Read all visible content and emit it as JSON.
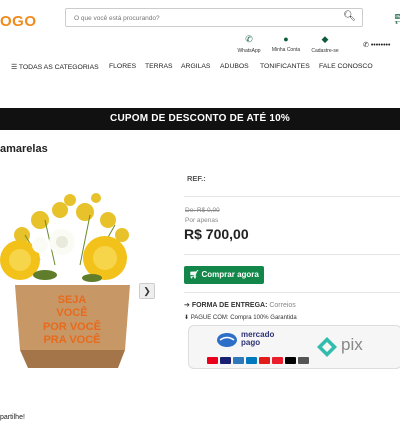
{
  "header": {
    "logo_text": "OGO",
    "search_placeholder": "O que você está procurando?",
    "icons": [
      {
        "icon": "whatsapp-icon",
        "label": "WhatsApp"
      },
      {
        "icon": "user-icon",
        "label": "Minha Conta"
      },
      {
        "icon": "register-icon",
        "label": "Cadastre-se"
      }
    ],
    "phone_text": "••••••••"
  },
  "nav": {
    "items": [
      "TODAS AS CATEGORIAS",
      "FLORES",
      "TERRAS",
      "ARGILAS",
      "ADUBOS",
      "TONIFICANTES",
      "FALE CONOSCO"
    ]
  },
  "banner": {
    "text": "CUPOM DE DESCONTO DE ATÉ 10%"
  },
  "product": {
    "title": "amarelas",
    "ref_label": "REF.:",
    "old_price": "De: R$ 0,00",
    "por_apenas": "Por apenas",
    "price": "R$ 700,00",
    "buy_label": "Comprar agora",
    "ship_label": "FORMA DE ENTREGA:",
    "ship_value": "Correios",
    "pay_label": "PAGUE COM:",
    "pay_value": "Compra 100% Garantida",
    "box_text": [
      "SEJA",
      "VOCÊ",
      "POR VOCÊ",
      "PRA VOCÊ"
    ]
  },
  "payment": {
    "mp_line1": "mercado",
    "mp_line2": "pago",
    "pix_label": "pix"
  },
  "share": {
    "text": "partilhe!"
  },
  "colors": {
    "brand_orange": "#f08a1c",
    "brand_green": "#0f5c3a",
    "buy_green": "#13874a",
    "banner_bg": "#111111"
  }
}
